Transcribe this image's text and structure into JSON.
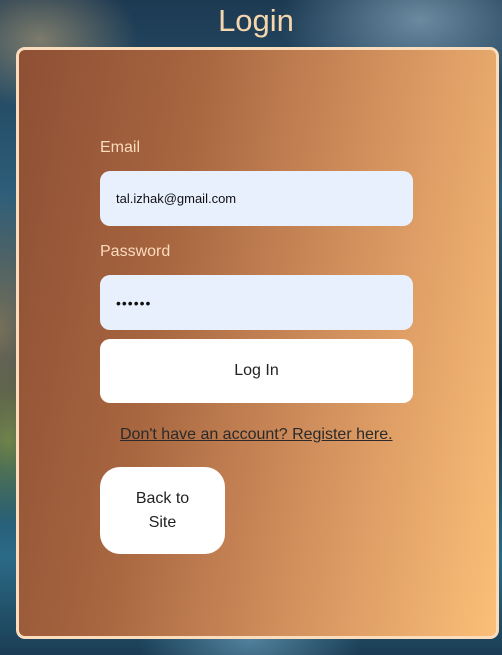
{
  "page": {
    "title": "Login"
  },
  "form": {
    "email_label": "Email",
    "email_value": "tal.izhak@gmail.com",
    "password_label": "Password",
    "password_value": "••••••",
    "login_button": "Log In",
    "register_link": "Don't have an account? Register here.",
    "back_button": "Back to Site"
  },
  "colors": {
    "title": "#f6d6ad",
    "card_border": "#fbdcbc",
    "card_gradient_start": "#8e4f34",
    "card_gradient_end": "#fbbf78",
    "input_background": "#e8f0fe",
    "button_background": "#ffffff"
  }
}
